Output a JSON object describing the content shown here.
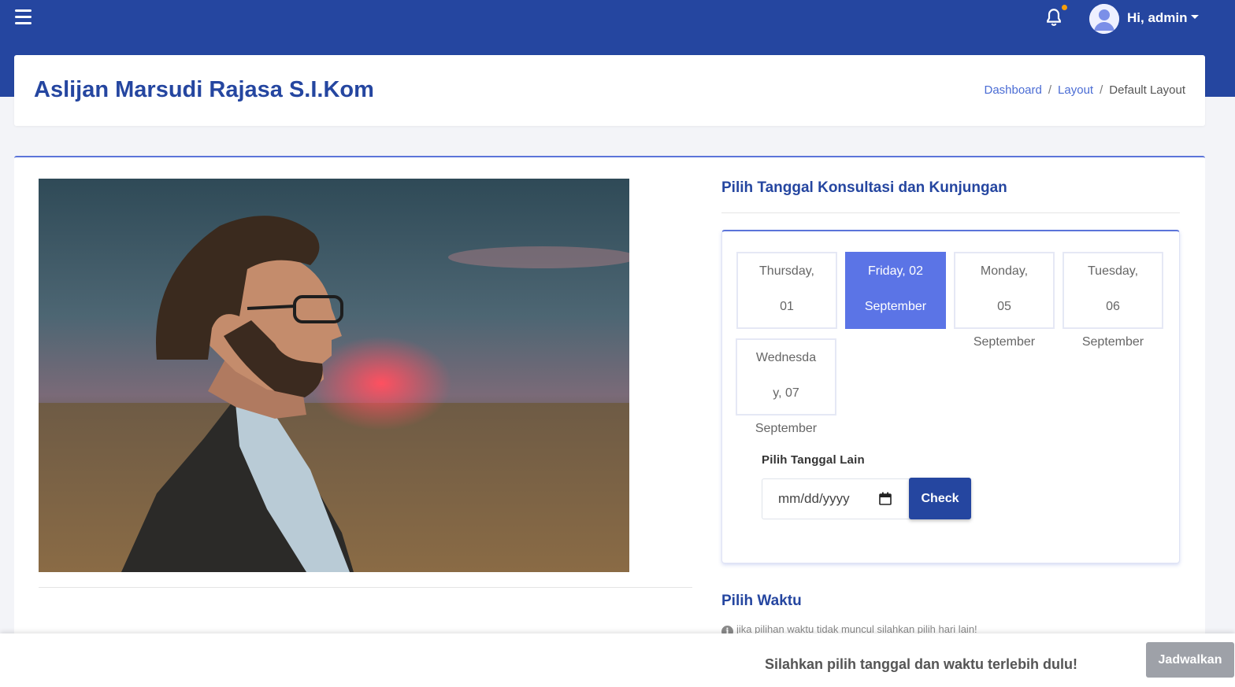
{
  "header": {
    "user_greeting": "Hi, admin",
    "accent_color": "#2546a0",
    "notification_dot_color": "#f59e0b"
  },
  "page": {
    "title": "Aslijan Marsudi Rajasa S.I.Kom",
    "breadcrumb": [
      "Dashboard",
      "Layout",
      "Default Layout"
    ]
  },
  "schedule": {
    "date_section_title": "Pilih Tanggal Konsultasi dan Kunjungan",
    "days": [
      {
        "line1": "Thursday,",
        "line2": "01",
        "line3": "September",
        "selected": false
      },
      {
        "line1": "Friday, 02",
        "line2": "September",
        "line3": "",
        "selected": true
      },
      {
        "line1": "Monday,",
        "line2": "05",
        "line3": "September",
        "selected": false
      },
      {
        "line1": "Tuesday,",
        "line2": "06",
        "line3": "September",
        "selected": false
      },
      {
        "line1": "Wednesda",
        "line2": "y, 07",
        "line3": "September",
        "selected": false
      }
    ],
    "other_date_label": "Pilih Tanggal Lain",
    "date_placeholder": "mm/dd/yyyy",
    "check_label": "Check",
    "time_section_title": "Pilih Waktu",
    "time_hint": "jika pilihan waktu tidak muncul silahkan pilih hari lain!",
    "selected_color": "#5b74e6"
  },
  "footer": {
    "message": "Silahkan pilih tanggal dan waktu terlebih dulu!",
    "schedule_button": "Jadwalkan"
  }
}
